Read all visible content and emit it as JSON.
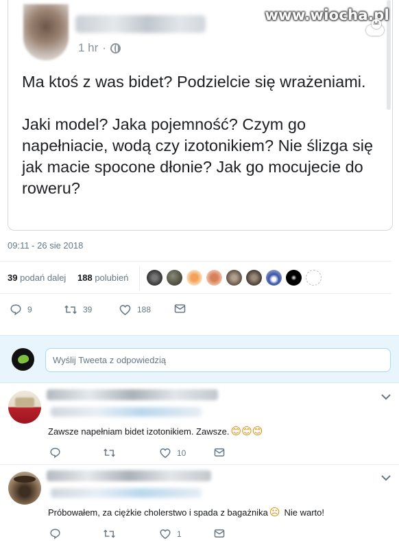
{
  "watermark": {
    "text": "www.wiocha.pl"
  },
  "post": {
    "meta_time": "1 hr",
    "meta_separator": "·",
    "text": "Ma ktoś z was bidet? Podzielcie się wrażeniami.\n\nJaki model? Jaka pojemność? Czym go napełniacie, wodą czy izotonikiem? Nie ślizga się jak macie spocone dłonie? Jak go mocujecie do roweru?"
  },
  "tweet": {
    "timestamp": "09:11 - 26 sie 2018",
    "retweets_count": "39",
    "retweets_label": "podań dalej",
    "likes_count": "188",
    "likes_label": "polubień",
    "actions": {
      "replies": "9",
      "retweets": "39",
      "likes": "188"
    }
  },
  "reply_box": {
    "placeholder": "Wyślij Tweeta z odpowiedzią"
  },
  "comments": [
    {
      "text": "Zawsze napełniam bidet izotonikiem. Zawsze.",
      "emoji": "😊😊😊",
      "actions": {
        "replies": "",
        "retweets": "",
        "likes": "10"
      }
    },
    {
      "text": "Próbowałem, za ciężkie cholerstwo i spada z bagażnika",
      "emoji": "☹",
      "text_after": "Nie warto!",
      "actions": {
        "replies": "",
        "retweets": "",
        "likes": "1"
      }
    }
  ],
  "colors": {
    "accent": "#1da1f2",
    "muted": "#657786",
    "reply_bg": "#e8f5fd"
  },
  "icons": [
    "globe-icon",
    "reply-icon",
    "retweet-icon",
    "like-icon",
    "message-icon",
    "chevron-down-icon"
  ]
}
